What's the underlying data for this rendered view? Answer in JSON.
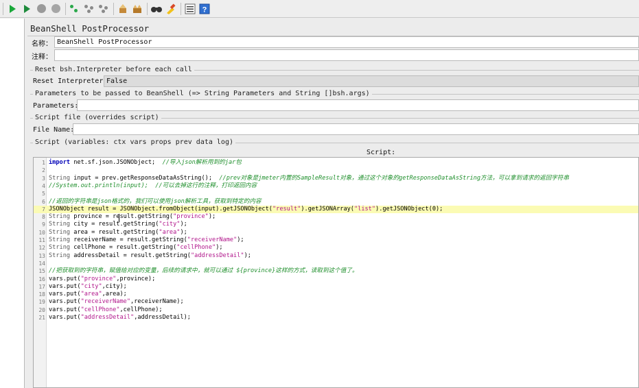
{
  "toolbar": {
    "buttons": [
      "start-icon",
      "start-no-pause-icon",
      "stop-icon",
      "shutdown-icon",
      "remote-start-icon",
      "remote-stop-icon",
      "remote-shutdown-icon",
      "clear-icon",
      "clear-all-icon",
      "search-icon",
      "reset-search-icon",
      "function-helper-icon",
      "help-icon"
    ]
  },
  "panel": {
    "title": "BeanShell PostProcessor",
    "name_label": "名称：",
    "name_value": "BeanShell PostProcessor",
    "comment_label": "注释：",
    "comment_value": "",
    "reset_group_title": "Reset bsh.Interpreter before each call",
    "reset_label": "Reset Interpreter:",
    "reset_value": "False",
    "params_group_title": "Parameters to be passed to BeanShell (=> String Parameters and String []bsh.args)",
    "params_label": "Parameters:",
    "params_value": "",
    "file_group_title": "Script file (overrides script)",
    "file_label": "File Name:",
    "file_value": "",
    "script_group_title": "Script (variables: ctx vars props prev data log)",
    "script_label": "Script:"
  },
  "script": {
    "highlighted_line": 7,
    "lines": [
      [
        {
          "t": "import",
          "c": "kw"
        },
        {
          "t": " net.sf.json.JSONObject;  "
        },
        {
          "t": "//导入json解析用到的jar包",
          "c": "cm"
        }
      ],
      [],
      [
        {
          "t": "String",
          "c": "ty"
        },
        {
          "t": " input = prev.getResponseDataAsString();  "
        },
        {
          "t": "//prev对象是jmeter内置的SampleResult对象，通过这个对象的getResponseDataAsString方法，可以拿到请求的返回字符串",
          "c": "cm"
        }
      ],
      [
        {
          "t": "//System.out.println(input);  //可以去掉这行的注释，打印返回内容",
          "c": "cm"
        }
      ],
      [],
      [
        {
          "t": "//返回的字符串是json格式的，我们可以使用json解析工具，获取到特定的内容",
          "c": "cm"
        }
      ],
      [
        {
          "t": "JSONObject result = JSONObject.fromObject(input).getJSONObject("
        },
        {
          "t": "\"result\"",
          "c": "st"
        },
        {
          "t": ").getJSONArray("
        },
        {
          "t": "\"list\"",
          "c": "st"
        },
        {
          "t": ").getJSONObject(0);"
        }
      ],
      [
        {
          "t": "String",
          "c": "ty"
        },
        {
          "t": " province = result.getString("
        },
        {
          "t": "\"province\"",
          "c": "st"
        },
        {
          "t": ");"
        }
      ],
      [
        {
          "t": "String",
          "c": "ty"
        },
        {
          "t": " city = result.getString("
        },
        {
          "t": "\"city\"",
          "c": "st"
        },
        {
          "t": ");"
        }
      ],
      [
        {
          "t": "String",
          "c": "ty"
        },
        {
          "t": " area = result.getString("
        },
        {
          "t": "\"area\"",
          "c": "st"
        },
        {
          "t": ");"
        }
      ],
      [
        {
          "t": "String",
          "c": "ty"
        },
        {
          "t": " receiverName = result.getString("
        },
        {
          "t": "\"receiverName\"",
          "c": "st"
        },
        {
          "t": ");"
        }
      ],
      [
        {
          "t": "String",
          "c": "ty"
        },
        {
          "t": " cellPhone = result.getString("
        },
        {
          "t": "\"cellPhone\"",
          "c": "st"
        },
        {
          "t": ");"
        }
      ],
      [
        {
          "t": "String",
          "c": "ty"
        },
        {
          "t": " addressDetail = result.getString("
        },
        {
          "t": "\"addressDetail\"",
          "c": "st"
        },
        {
          "t": ");"
        }
      ],
      [],
      [
        {
          "t": "//把获取到的字符串，赋值给对应的变量，后续的请求中，就可以通过 ${province}这样的方式，读取到这个值了。",
          "c": "cm"
        }
      ],
      [
        {
          "t": "vars.put("
        },
        {
          "t": "\"province\"",
          "c": "st"
        },
        {
          "t": ",province);"
        }
      ],
      [
        {
          "t": "vars.put("
        },
        {
          "t": "\"city\"",
          "c": "st"
        },
        {
          "t": ",city);"
        }
      ],
      [
        {
          "t": "vars.put("
        },
        {
          "t": "\"area\"",
          "c": "st"
        },
        {
          "t": ",area);"
        }
      ],
      [
        {
          "t": "vars.put("
        },
        {
          "t": "\"receiverName\"",
          "c": "st"
        },
        {
          "t": ",receiverName);"
        }
      ],
      [
        {
          "t": "vars.put("
        },
        {
          "t": "\"cellPhone\"",
          "c": "st"
        },
        {
          "t": ",cellPhone);"
        }
      ],
      [
        {
          "t": "vars.put("
        },
        {
          "t": "\"addressDetail\"",
          "c": "st"
        },
        {
          "t": ",addressDetail);"
        }
      ]
    ]
  }
}
